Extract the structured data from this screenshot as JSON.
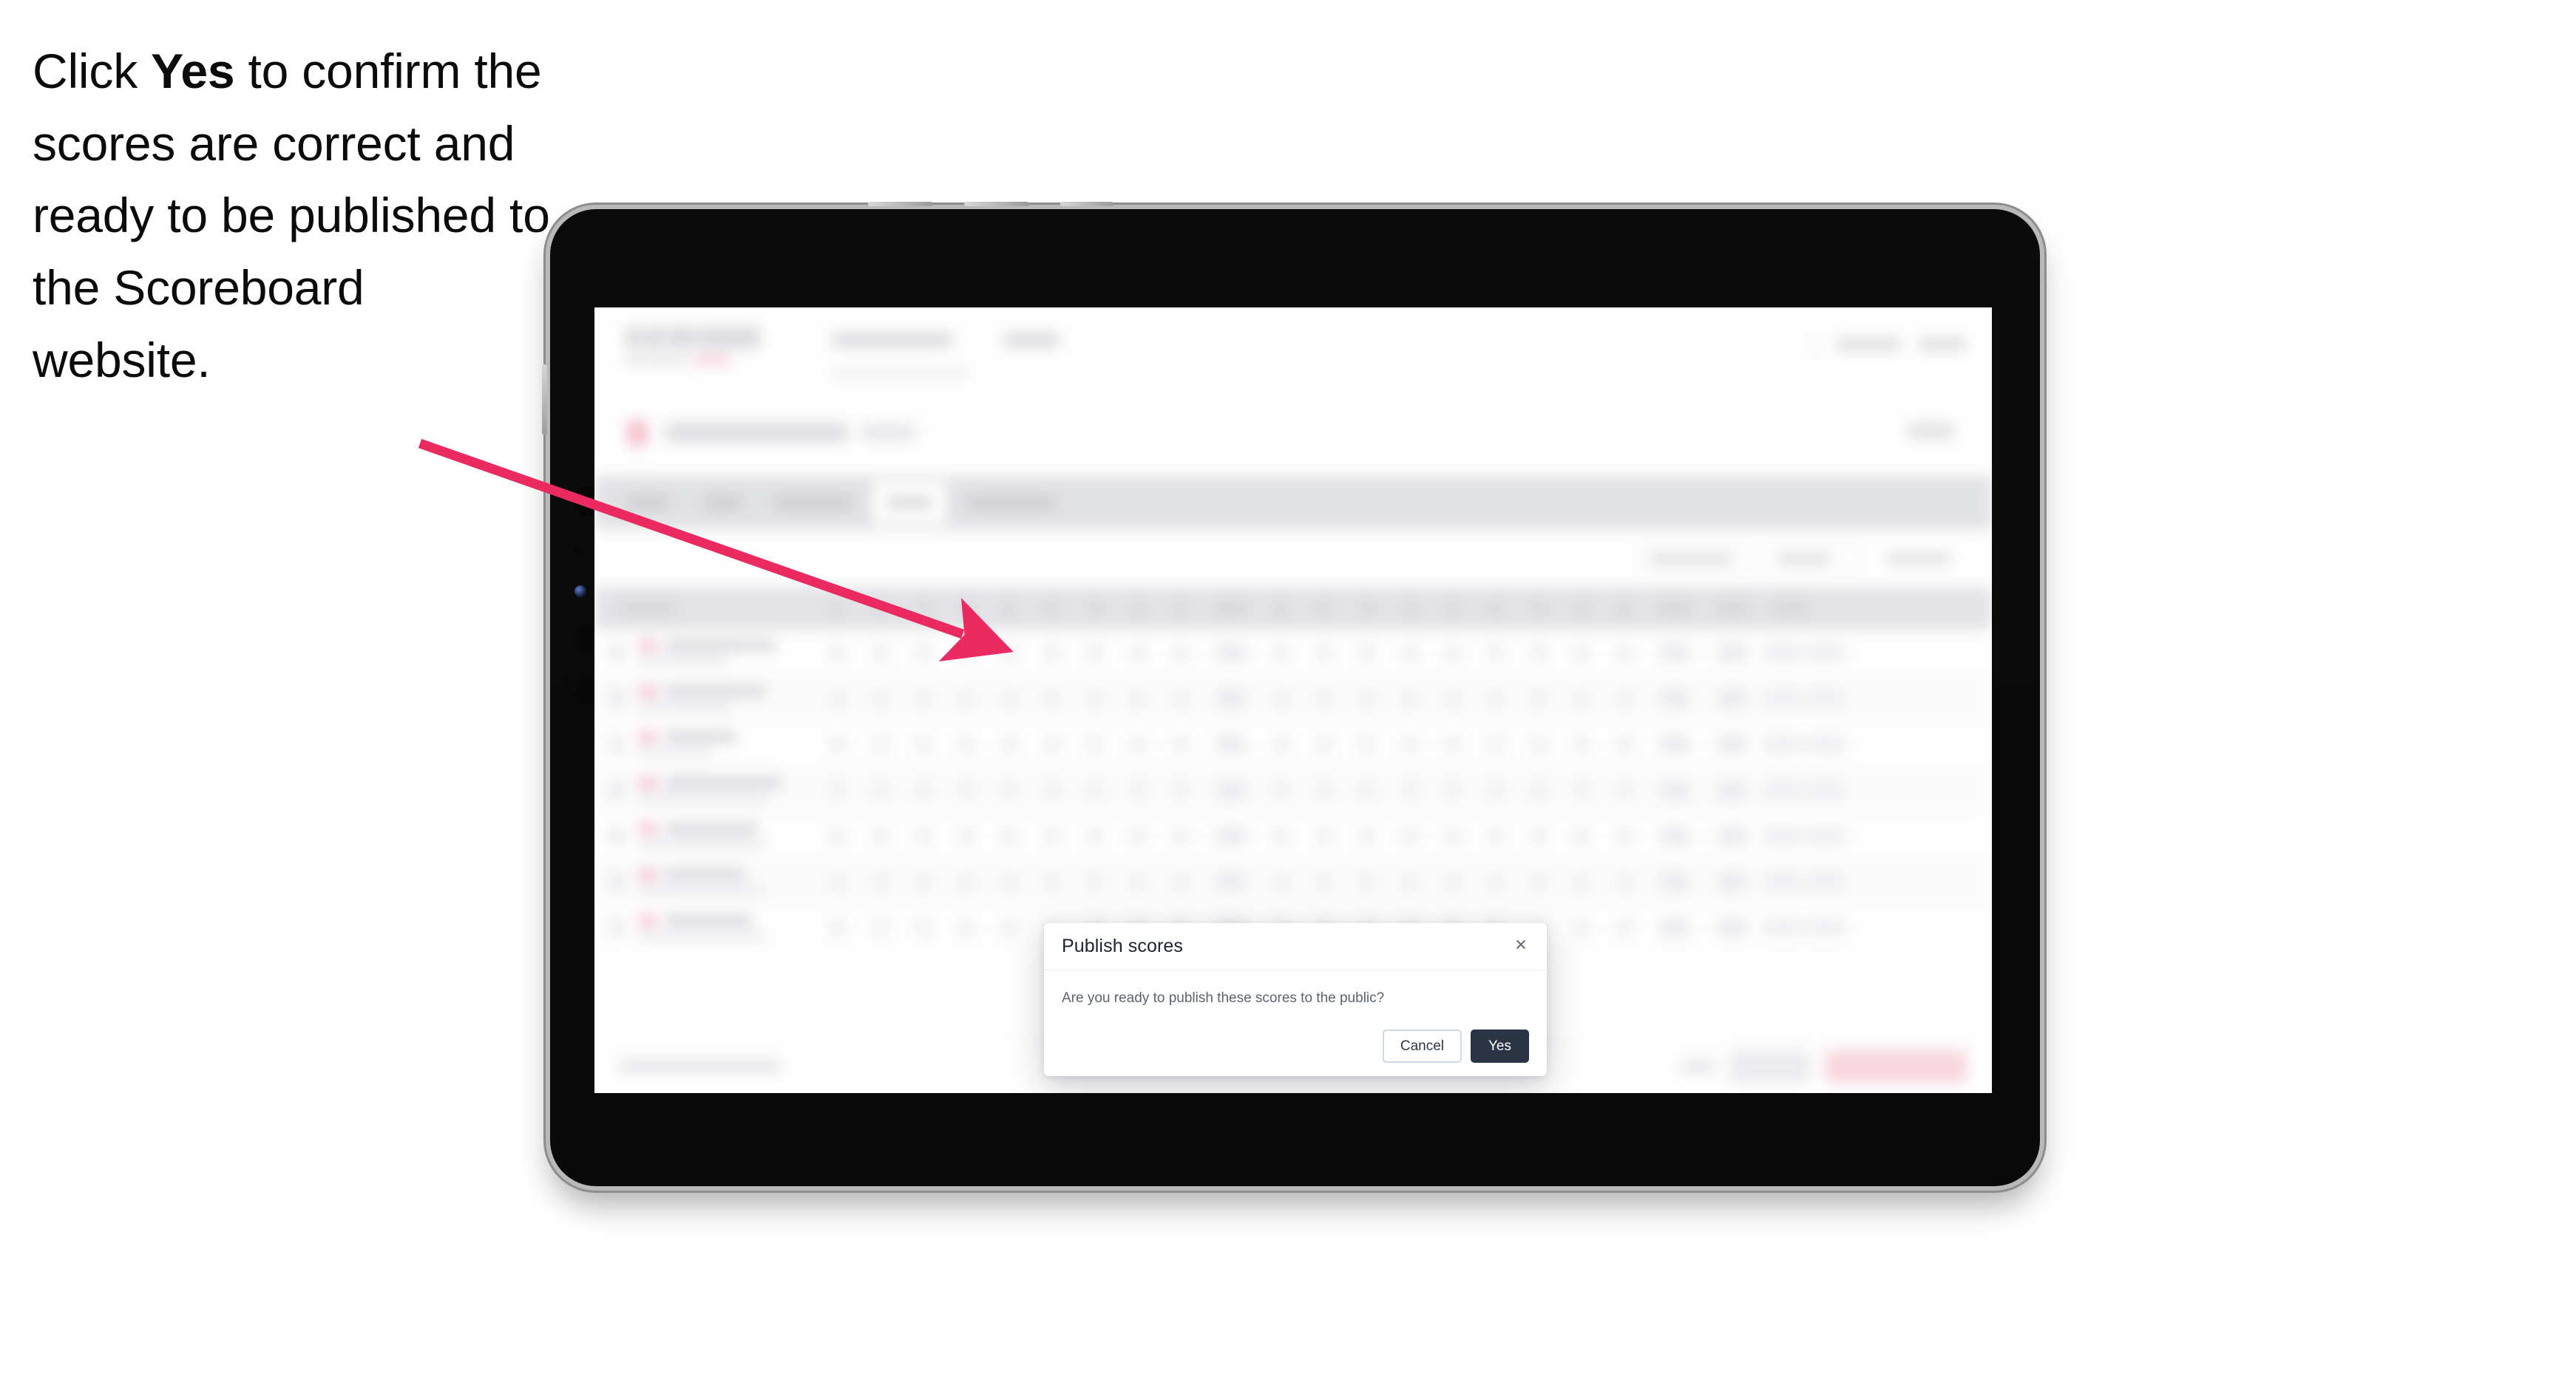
{
  "caption": {
    "before": "Click ",
    "bold": "Yes",
    "after": " to confirm the scores are correct and ready to be published to the Scoreboard website."
  },
  "colors": {
    "annotation_arrow": "#ea2a60",
    "modal_primary_button": "#2b3444",
    "modal_cancel_border": "#ccd9ea",
    "device_frame": "#0b0b0b",
    "device_metal": "#b9b9b9",
    "tab_strip": "#d6d7db",
    "brand_pink": "#f4a7bd"
  },
  "device": {
    "type": "tablet",
    "orientation": "landscape"
  },
  "modal": {
    "title": "Publish scores",
    "message": "Are you ready to publish these scores to the public?",
    "close_icon": "×",
    "buttons": {
      "cancel": "Cancel",
      "confirm": "Yes"
    }
  },
  "background_app": {
    "blurred": true,
    "logo": "SCOREBOARD",
    "nav_items": [
      "Tournaments",
      "Players"
    ],
    "topright_items": [
      "Help centre",
      "Account"
    ],
    "tabs": [
      {
        "label": "Teams",
        "active": false
      },
      {
        "label": "Draw",
        "active": false
      },
      {
        "label": "Course setup",
        "active": false
      },
      {
        "label": "Results",
        "active": true
      },
      {
        "label": "Leaderboard",
        "active": false
      }
    ],
    "filters": [
      "All rounds",
      "Round 1",
      "Team only"
    ],
    "table": {
      "columns": [
        "Player",
        "1",
        "2",
        "3",
        "4",
        "5",
        "6",
        "7",
        "8",
        "9",
        "Out",
        "10",
        "11",
        "12",
        "13",
        "14",
        "15",
        "16",
        "17",
        "18",
        "In",
        "Total",
        "Par",
        "Gross",
        "Nett"
      ],
      "row_count": 7
    },
    "bottom_bar": {
      "note": "No results published successfully",
      "link": "Cancel",
      "secondary_button": "Save",
      "primary_button": "Publish scores to public"
    }
  }
}
